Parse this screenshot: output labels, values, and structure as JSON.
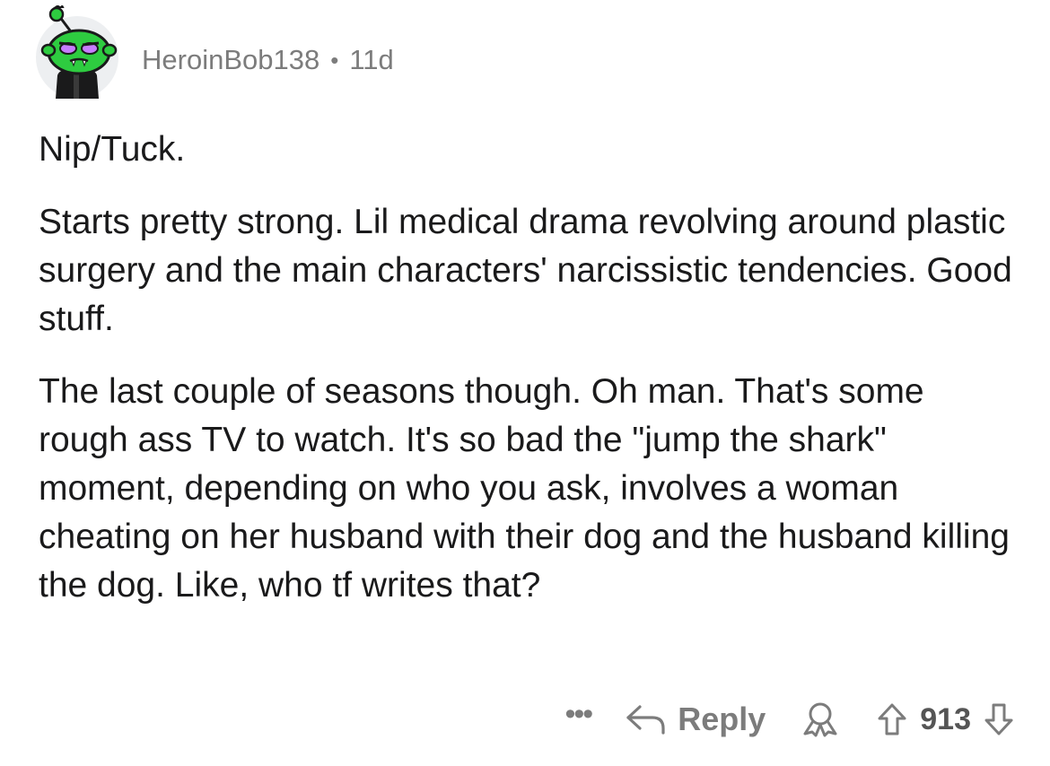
{
  "comment": {
    "username": "HeroinBob138",
    "separator": "•",
    "age": "11d",
    "paragraphs": [
      "Nip/Tuck.",
      "Starts pretty strong. Lil medical drama revolving around plastic surgery and the main characters' narcissistic tendencies. Good stuff.",
      "The last couple of seasons though. Oh man. That's some rough ass TV to watch. It's so bad the \"jump the shark\" moment, depending on who you ask, involves a woman cheating on her husband with their dog and the husband killing the dog. Like, who tf writes that?"
    ]
  },
  "actions": {
    "more": "•••",
    "reply_label": "Reply",
    "score": "913"
  },
  "icons": {
    "avatar": "snoo-avatar-icon",
    "more": "more-options-icon",
    "reply": "reply-arrow-icon",
    "award": "award-icon",
    "upvote": "upvote-arrow-icon",
    "downvote": "downvote-arrow-icon"
  },
  "colors": {
    "text": "#1a1a1b",
    "meta": "#7c7c7c",
    "avatar_green": "#2ecc40",
    "avatar_bg": "#edeff1"
  }
}
